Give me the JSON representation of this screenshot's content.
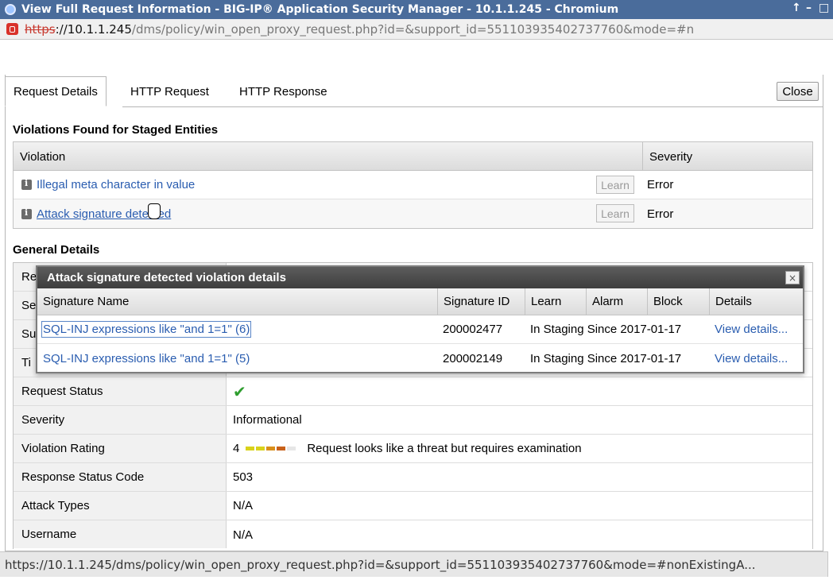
{
  "window": {
    "title": "View Full Request Information - BIG-IP® Application Security Manager - 10.1.1.245 - Chromium",
    "controls": [
      "↑",
      "–",
      "□"
    ]
  },
  "urlbar": {
    "scheme": "https",
    "host": "://10.1.1.245",
    "path": "/dms/policy/win_open_proxy_request.php?id=&support_id=551103935402737760&mode=#n"
  },
  "tabs": [
    {
      "label": "Request Details",
      "active": true
    },
    {
      "label": "HTTP Request",
      "active": false
    },
    {
      "label": "HTTP Response",
      "active": false
    }
  ],
  "close_label": "Close",
  "violations": {
    "title": "Violations Found for Staged Entities",
    "col_violation": "Violation",
    "col_severity": "Severity",
    "rows": [
      {
        "name": "Illegal meta character in value",
        "learn": "Learn",
        "severity": "Error"
      },
      {
        "name": "Attack signature detected",
        "learn": "Learn",
        "severity": "Error"
      }
    ]
  },
  "general": {
    "title": "General Details",
    "rows": [
      {
        "label": "Re",
        "value": ""
      },
      {
        "label": "Se",
        "value": ""
      },
      {
        "label": "Su",
        "value": ""
      },
      {
        "label": "Ti",
        "value": ""
      },
      {
        "label": "Request Status",
        "value": "✔"
      },
      {
        "label": "Severity",
        "value": "Informational"
      },
      {
        "label": "Violation Rating",
        "value": "4",
        "rating_text": "Request looks like a threat but requires examination"
      },
      {
        "label": "Response Status Code",
        "value": "503"
      },
      {
        "label": "Attack Types",
        "value": "N/A"
      },
      {
        "label": "Username",
        "value": "N/A"
      }
    ],
    "rating_colors": [
      "#d9d21a",
      "#d9d21a",
      "#d98f1a",
      "#c8611a",
      "#e6e6e6"
    ]
  },
  "popup": {
    "title": "Attack signature detected violation details",
    "close": "×",
    "headers": {
      "name": "Signature Name",
      "id": "Signature ID",
      "learn": "Learn",
      "alarm": "Alarm",
      "block": "Block",
      "details": "Details"
    },
    "rows": [
      {
        "name": "SQL-INJ expressions like \"and 1=1\" (6)",
        "id": "200002477",
        "learn": "In Staging Since 2017-01-17",
        "details": "View details..."
      },
      {
        "name": "SQL-INJ expressions like \"and 1=1\" (5)",
        "id": "200002149",
        "learn": "In Staging Since 2017-01-17",
        "details": "View details..."
      }
    ]
  },
  "statusbar": {
    "text": "https://10.1.1.245/dms/policy/win_open_proxy_request.php?id=&support_id=551103935402737760&mode=#nonExistingA..."
  }
}
